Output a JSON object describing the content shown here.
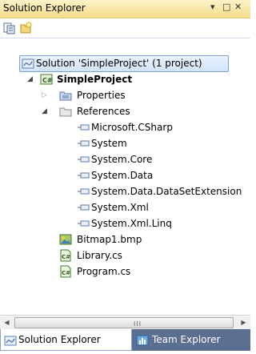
{
  "window": {
    "title": "Solution Explorer"
  },
  "titlebar": {
    "pin_glyph": "▾",
    "maximize_glyph": "□",
    "close_glyph": "✕"
  },
  "tree": {
    "solution_label": "Solution 'SimpleProject' (1 project)",
    "project_label": "SimpleProject",
    "properties_label": "Properties",
    "references_label": "References",
    "references": [
      "Microsoft.CSharp",
      "System",
      "System.Core",
      "System.Data",
      "System.Data.DataSetExtension",
      "System.Xml",
      "System.Xml.Linq"
    ],
    "files": [
      "Bitmap1.bmp",
      "Library.cs",
      "Program.cs"
    ]
  },
  "scrollbar": {
    "grip_glyph": "III"
  },
  "tabs": [
    "Solution Explorer",
    "Team Explorer"
  ]
}
